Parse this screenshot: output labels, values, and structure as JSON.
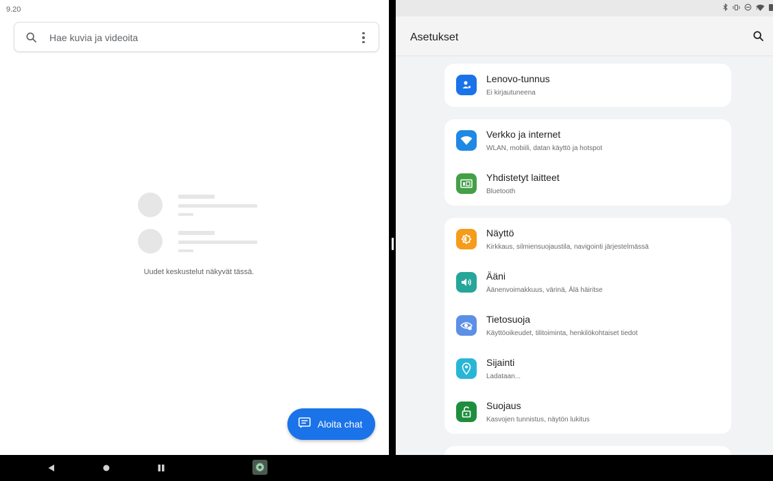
{
  "left_pane": {
    "time": "9.20",
    "search": {
      "placeholder": "Hae kuvia ja videoita",
      "icon": "search-icon",
      "menu_icon": "more-vert-icon"
    },
    "empty_state_text": "Uudet keskustelut näkyvät tässä.",
    "fab": {
      "label": "Aloita chat",
      "icon": "chat-icon",
      "color": "#1a73e8"
    }
  },
  "right_pane": {
    "status_icons": [
      "bluetooth-icon",
      "vibrate-icon",
      "dnd-icon",
      "wifi-icon",
      "battery-icon"
    ],
    "title": "Asetukset",
    "search_icon": "search-icon",
    "groups": [
      {
        "items": [
          {
            "title": "Lenovo-tunnus",
            "subtitle": "Ei kirjautuneena",
            "icon": "account-icon",
            "color": "#1a73e8"
          }
        ]
      },
      {
        "items": [
          {
            "title": "Verkko ja internet",
            "subtitle": "WLAN, mobiili, datan käyttö ja hotspot",
            "icon": "wifi-icon",
            "color": "#1e88e5"
          },
          {
            "title": "Yhdistetyt laitteet",
            "subtitle": "Bluetooth",
            "icon": "devices-icon",
            "color": "#43a047"
          }
        ]
      },
      {
        "items": [
          {
            "title": "Näyttö",
            "subtitle": "Kirkkaus, silmiensuojaustila, navigointi järjestelmässä",
            "icon": "brightness-icon",
            "color": "#f59c1a"
          },
          {
            "title": "Ääni",
            "subtitle": "Äänenvoimakkuus, värinä, Älä häiritse",
            "icon": "volume-icon",
            "color": "#26a69a"
          },
          {
            "title": "Tietosuoja",
            "subtitle": "Käyttöoikeudet, tilitoiminta, henkilökohtaiset tiedot",
            "icon": "privacy-icon",
            "color": "#5c8fe6"
          },
          {
            "title": "Sijainti",
            "subtitle": "Ladataan...",
            "icon": "location-icon",
            "color": "#29b6d6"
          },
          {
            "title": "Suojaus",
            "subtitle": "Kasvojen tunnistus, näytön lukitus",
            "icon": "lock-icon",
            "color": "#1e8e3e"
          }
        ]
      }
    ]
  },
  "navbar": {
    "buttons": [
      "back-icon",
      "home-icon",
      "recents-icon"
    ],
    "pinned_app": "settings-icon"
  }
}
